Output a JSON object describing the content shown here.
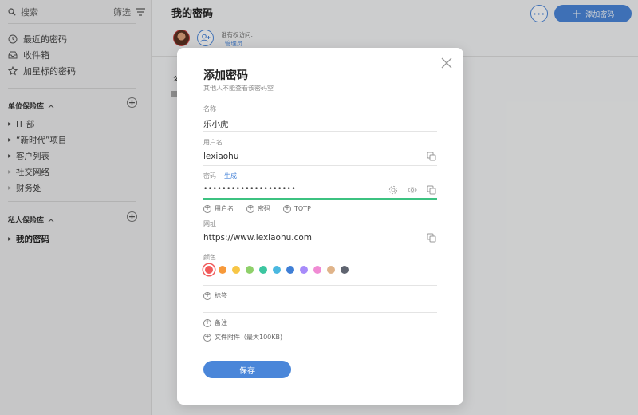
{
  "sidebar": {
    "search_placeholder": "搜索",
    "filter_label": "筛选",
    "nav": [
      {
        "label": "最近的密码",
        "icon": "clock-icon"
      },
      {
        "label": "收件箱",
        "icon": "inbox-icon"
      },
      {
        "label": "加星标的密码",
        "icon": "star-icon"
      }
    ],
    "org_vault_header": "单位保险库",
    "org_vaults": [
      "IT 部",
      "“新时代”项目",
      "客户列表",
      "社交网络",
      "财务处"
    ],
    "private_vault_header": "私人保险库",
    "private_vaults": [
      "我的密码"
    ]
  },
  "main": {
    "title": "我的密码",
    "add_password_label": "添加密码",
    "access_label": "谁有权访问:",
    "access_link": "1管理员",
    "peek_text": "文"
  },
  "modal": {
    "title": "添加密码",
    "subtitle": "其他人不能查看该密码空",
    "name_label": "名称",
    "name_value": "乐小虎",
    "username_label": "用户名",
    "username_value": "lexiaohu",
    "password_label": "密码",
    "generate_label": "生成",
    "password_value": "••••••••••••••••••••",
    "add_options": [
      "用户名",
      "密码",
      "TOTP"
    ],
    "url_label": "网址",
    "url_value": "https://www.lexiaohu.com",
    "color_label": "颜色",
    "colors": [
      "#f15b5b",
      "#f7993a",
      "#f7c646",
      "#8fd06a",
      "#3cc6a0",
      "#4ab8e0",
      "#3f7fd6",
      "#a78bfa",
      "#f08bd4",
      "#e0b48a",
      "#5f6470"
    ],
    "selected_color": "#f15b5b",
    "tags_label": "标签",
    "notes_label": "备注",
    "attachment_label": "文件附件（最大100KB)",
    "save_label": "保存"
  }
}
